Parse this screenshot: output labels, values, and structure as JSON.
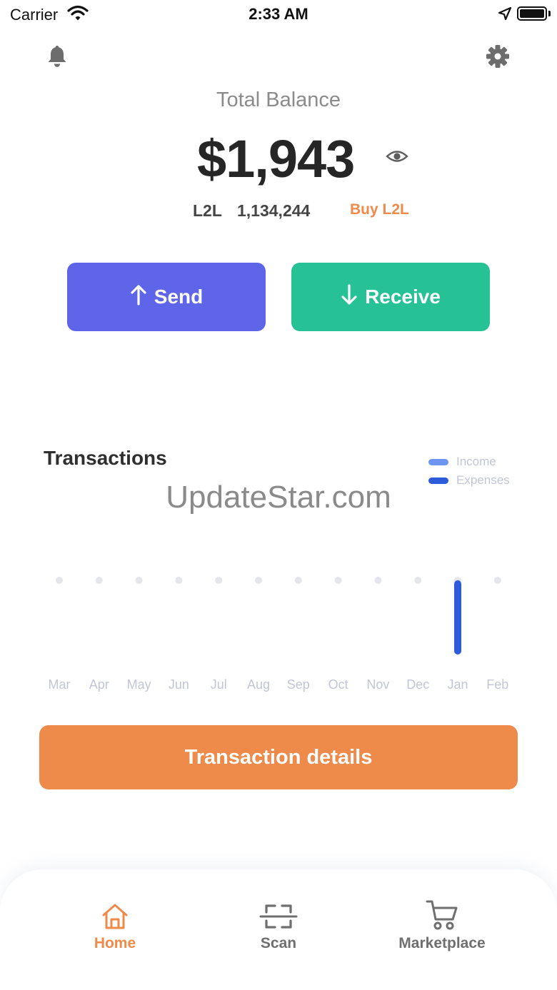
{
  "status_bar": {
    "carrier": "Carrier",
    "time": "2:33 AM"
  },
  "header": {
    "icons": [
      "bell-icon",
      "gear-icon"
    ]
  },
  "balance": {
    "label": "Total Balance",
    "value": "$1,943",
    "token_symbol": "L2L",
    "token_amount": "1,134,244",
    "buy_label": "Buy L2L"
  },
  "actions": {
    "send_label": "Send",
    "receive_label": "Receive"
  },
  "transactions": {
    "title": "Transactions",
    "legend": [
      {
        "name": "Income",
        "color": "#6f95f2"
      },
      {
        "name": "Expenses",
        "color": "#2d5bd9"
      }
    ]
  },
  "watermark": "UpdateStar.com",
  "chart_data": {
    "type": "bar",
    "categories": [
      "Mar",
      "Apr",
      "May",
      "Jun",
      "Jul",
      "Aug",
      "Sep",
      "Oct",
      "Nov",
      "Dec",
      "Jan",
      "Feb"
    ],
    "series": [
      {
        "name": "Income",
        "values": [
          0,
          0,
          0,
          0,
          0,
          0,
          0,
          0,
          0,
          0,
          0,
          0
        ]
      },
      {
        "name": "Expenses",
        "values": [
          0,
          0,
          0,
          0,
          0,
          0,
          0,
          0,
          0,
          0,
          1,
          0
        ]
      }
    ],
    "xlabel": "",
    "ylabel": "",
    "ylim": [
      0,
      1
    ],
    "grid": false,
    "legend": "top-right"
  },
  "details_button": "Transaction details",
  "tabbar": {
    "active": "home",
    "active_color": "#ee8a4a",
    "inactive_color": "#6f6f6f",
    "tabs": [
      {
        "id": "home",
        "label": "Home",
        "icon": "home-icon"
      },
      {
        "id": "scan",
        "label": "Scan",
        "icon": "scan-icon"
      },
      {
        "id": "market",
        "label": "Marketplace",
        "icon": "cart-icon"
      }
    ]
  }
}
